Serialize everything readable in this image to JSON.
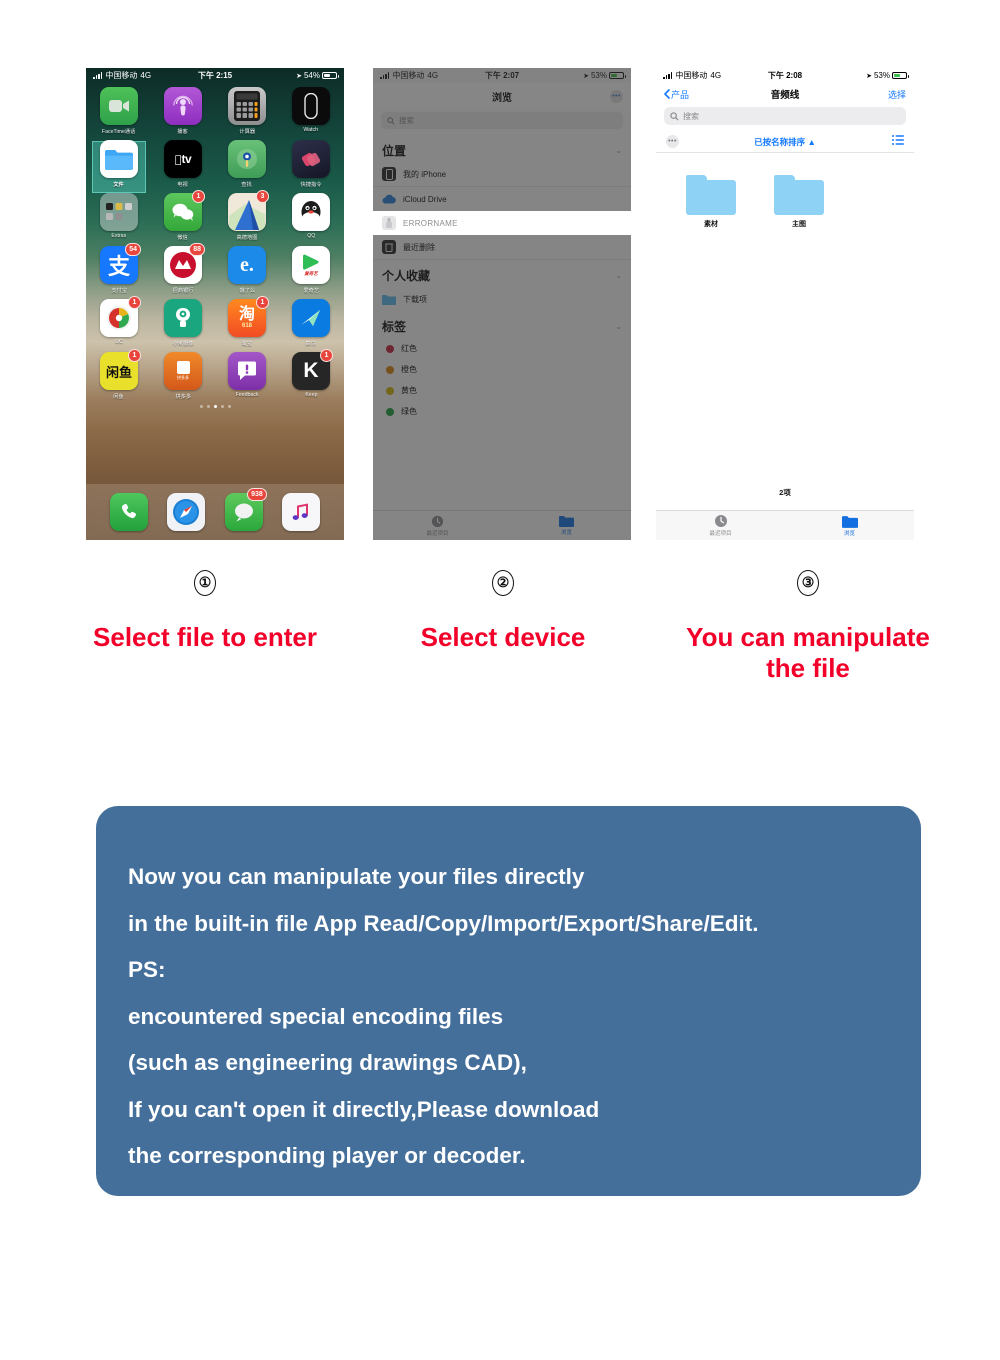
{
  "phone1": {
    "status": {
      "carrier": "中国移动",
      "network": "4G",
      "time": "下午 2:15",
      "battery": "54%"
    },
    "apps": [
      [
        {
          "label": "FaceTime通话",
          "icon": "facetime-icon",
          "badge": null
        },
        {
          "label": "播客",
          "icon": "podcasts-icon",
          "badge": null
        },
        {
          "label": "计算器",
          "icon": "calculator-icon",
          "badge": null
        },
        {
          "label": "Watch",
          "icon": "watch-icon",
          "badge": null
        }
      ],
      [
        {
          "label": "文件",
          "icon": "files-icon",
          "badge": null
        },
        {
          "label": "电视",
          "icon": "appletv-icon",
          "badge": null
        },
        {
          "label": "查找",
          "icon": "findmy-icon",
          "badge": null
        },
        {
          "label": "快捷指令",
          "icon": "shortcuts-icon",
          "badge": null
        }
      ],
      [
        {
          "label": "Extras",
          "icon": "extras-folder-icon",
          "badge": null
        },
        {
          "label": "微信",
          "icon": "wechat-icon",
          "badge": "1"
        },
        {
          "label": "高德地图",
          "icon": "amap-icon",
          "badge": "3"
        },
        {
          "label": "QQ",
          "icon": "qq-icon",
          "badge": null
        }
      ],
      [
        {
          "label": "支付宝",
          "icon": "alipay-icon",
          "badge": "54"
        },
        {
          "label": "招商银行",
          "icon": "cmb-icon",
          "badge": "88"
        },
        {
          "label": "饿了么",
          "icon": "eleme-icon",
          "badge": null
        },
        {
          "label": "爱奇艺",
          "icon": "iqiyi-icon",
          "badge": null
        }
      ],
      [
        {
          "label": "UC",
          "icon": "uc-icon",
          "badge": "1"
        },
        {
          "label": "小米摄像",
          "icon": "camera-app-icon",
          "badge": null
        },
        {
          "label": "淘宝",
          "icon": "taobao-icon",
          "badge": "1"
        },
        {
          "label": "菜鸟",
          "icon": "cainiao-icon",
          "badge": null
        }
      ],
      [
        {
          "label": "闲鱼",
          "icon": "xianyu-icon",
          "badge": "1"
        },
        {
          "label": "拼多多",
          "icon": "pinduoduo-icon",
          "badge": null
        },
        {
          "label": "Feedback",
          "icon": "feedback-icon",
          "badge": null
        },
        {
          "label": "Keep",
          "icon": "keep-icon",
          "badge": "1"
        }
      ]
    ],
    "dock": [
      {
        "label": "电话",
        "icon": "phone-icon",
        "badge": null
      },
      {
        "label": "Safari",
        "icon": "safari-icon",
        "badge": null
      },
      {
        "label": "信息",
        "icon": "messages-icon",
        "badge": "938"
      },
      {
        "label": "音乐",
        "icon": "music-icon",
        "badge": null
      }
    ]
  },
  "phone2": {
    "status": {
      "carrier": "中国移动",
      "network": "4G",
      "time": "下午 2:07",
      "battery": "53%"
    },
    "nav": {
      "title": "浏览",
      "more_label": "•••"
    },
    "search": {
      "placeholder": "搜索",
      "icon": "search-icon"
    },
    "sections": [
      {
        "title": "位置",
        "chevron": "chevron-down-icon",
        "rows": [
          {
            "label": "我的 iPhone",
            "icon": "iphone-icon"
          },
          {
            "label": "iCloud Drive",
            "icon": "icloud-icon"
          }
        ]
      }
    ],
    "highlighted_row": {
      "label": "ERRORNAME",
      "icon": "usb-drive-icon"
    },
    "after_rows": [
      {
        "label": "最近删除",
        "icon": "trash-icon"
      }
    ],
    "favorites": {
      "title": "个人收藏",
      "chevron": "chevron-down-icon",
      "rows": [
        {
          "label": "下载项",
          "icon": "folder-icon"
        }
      ]
    },
    "tags": {
      "title": "标签",
      "chevron": "chevron-down-icon",
      "rows": [
        {
          "label": "红色",
          "color": "#c3263c"
        },
        {
          "label": "橙色",
          "color": "#d9800f"
        },
        {
          "label": "黄色",
          "color": "#cfb40d"
        },
        {
          "label": "绿色",
          "color": "#1e9e3e"
        }
      ]
    },
    "tabs": [
      {
        "label": "最近项目",
        "icon": "clock-icon",
        "active": false
      },
      {
        "label": "浏览",
        "icon": "folder-icon",
        "active": true
      }
    ]
  },
  "phone3": {
    "status": {
      "carrier": "中国移动",
      "network": "4G",
      "time": "下午 2:08",
      "battery": "53%"
    },
    "nav": {
      "back_label": "产品",
      "title": "音频线",
      "action_label": "选择"
    },
    "search": {
      "placeholder": "搜索",
      "icon": "search-icon"
    },
    "sortbar": {
      "more_label": "•••",
      "sort_label": "已按名称排序 ▲",
      "view_icon": "list-view-icon"
    },
    "folders": [
      {
        "name": "素材",
        "icon": "folder-icon"
      },
      {
        "name": "主图",
        "icon": "folder-icon"
      }
    ],
    "item_count": "2项",
    "tabs": [
      {
        "label": "最近项目",
        "icon": "clock-icon",
        "active": false
      },
      {
        "label": "浏览",
        "icon": "folder-icon",
        "active": true
      }
    ]
  },
  "captions": [
    {
      "number": "①",
      "text": "Select file to enter"
    },
    {
      "number": "②",
      "text": "Select device"
    },
    {
      "number": "③",
      "text": "You can manipulate\nthe file"
    }
  ],
  "note": {
    "bg_color": "#446f9b",
    "lines": [
      "Now you can manipulate your files directly",
      "in the built-in file App Read/Copy/Import/Export/Share/Edit.",
      "PS:",
      "encountered special encoding files",
      "(such as engineering drawings CAD),",
      "If you can't open it directly,Please download",
      "the corresponding player or decoder."
    ]
  },
  "colors": {
    "caption_red": "#f2002a",
    "note_blue": "#446f9b",
    "ios_blue": "#1479ff"
  }
}
